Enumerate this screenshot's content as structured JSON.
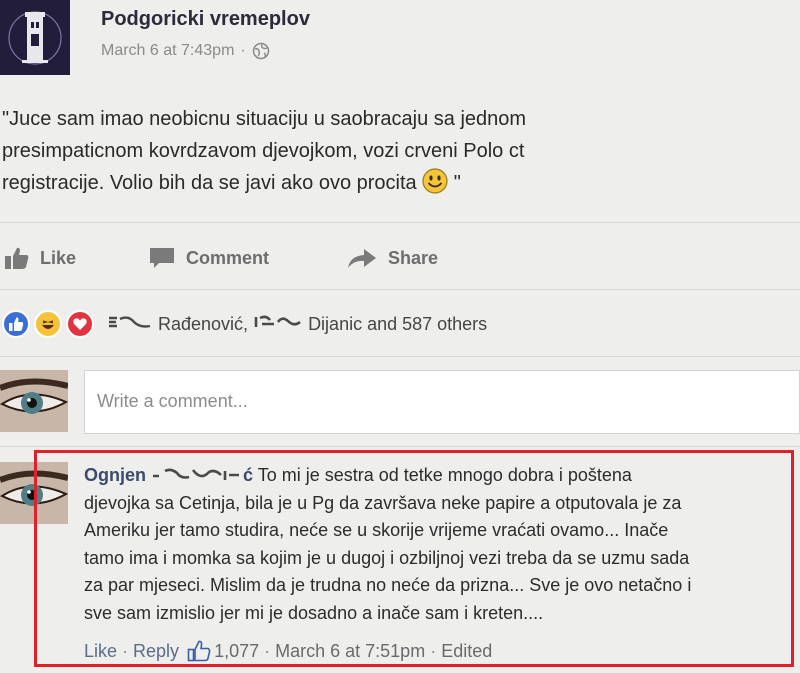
{
  "post": {
    "page_name": "Podgoricki vremeplov",
    "timestamp": "March 6 at 7:43pm",
    "meta_separator": "·",
    "body_lines": [
      "\"Juce sam imao neobicnu situaciju u saobracaju sa jednom",
      "presimpaticnom kovrdzavom djevojkom, vozi crveni Polo ct",
      "registracije. Volio bih da se javi ako ovo procita"
    ],
    "body_end": " \""
  },
  "actions": {
    "like": "Like",
    "comment": "Comment",
    "share": "Share"
  },
  "reactions": {
    "types": [
      "like-icon",
      "haha-icon",
      "love-icon"
    ],
    "name1": "Rađenović,",
    "name2": "Dijanic and 587 others"
  },
  "comment_input": {
    "placeholder": "Write a comment..."
  },
  "comment": {
    "author": "Ognjen",
    "author_suffix": "ć",
    "first_line": "To mi je sestra od tetke mnogo dobra i poštena",
    "lines": [
      "djevojka sa Cetinja, bila je u Pg da završava neke papire a otputovala je za",
      "Ameriku jer tamo studira, neće se u skorije vrijeme vraćati ovamo... Inače",
      "tamo ima i momka sa kojim je u dugoj i ozbiljnoj vezi treba da se uzmu sada",
      "za par mjeseci. Mislim da je trudna no neće da prizna... Sve je ovo netačno i",
      "sve sam izmislio jer mi je dosadno a inače sam i kreten...."
    ],
    "like_label": "Like",
    "reply_label": "Reply",
    "separator": "·",
    "like_count": "1,077",
    "timestamp": "March 6 at 7:51pm",
    "edited": "Edited"
  },
  "colors": {
    "highlight_border": "#e0202a",
    "like_blue": "#3b6fd6",
    "love_red": "#e2343f",
    "haha_yellow": "#f5c33b"
  }
}
